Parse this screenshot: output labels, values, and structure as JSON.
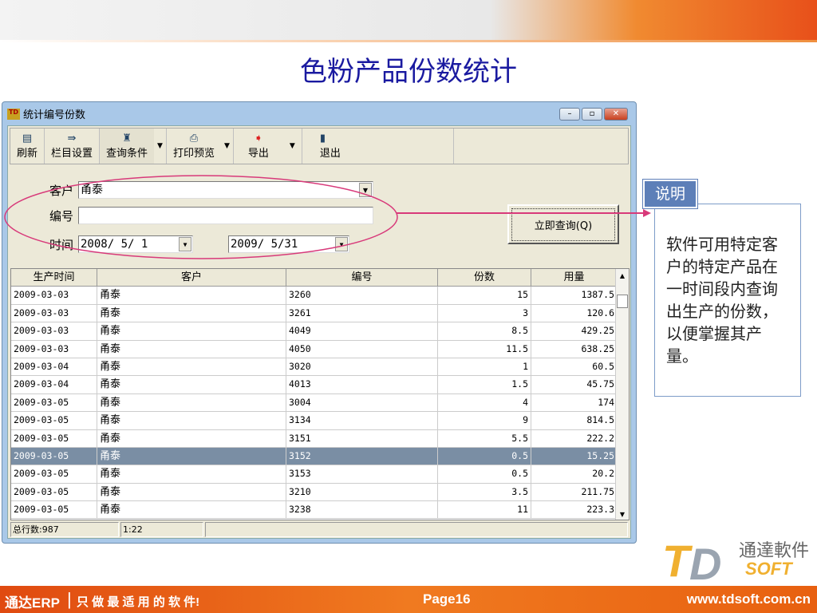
{
  "slide": {
    "title": "色粉产品份数统计",
    "page": "Page16",
    "url": "www.tdsoft.com.cn",
    "footer_brand": "通达ERP",
    "footer_slogan": "只 做 最 适 用 的 软 件!",
    "logo_text": "通達軟件",
    "logo_sub": "SOFT",
    "logo_mark": "TD"
  },
  "window": {
    "title": "统计编号份数",
    "min": "–",
    "max": "▫",
    "close": "✕"
  },
  "toolbar": [
    {
      "label": "刷新",
      "icon": "▤"
    },
    {
      "label": "栏目设置",
      "icon": "⇛"
    },
    {
      "label": "查询条件",
      "icon": "♜"
    },
    {
      "label": "打印预览",
      "icon": "⎙"
    },
    {
      "label": "导出",
      "icon": "➧"
    },
    {
      "label": "退出",
      "icon": "▮"
    }
  ],
  "form": {
    "customer_label": "客户",
    "customer_value": "甬泰",
    "code_label": "编号",
    "code_value": "",
    "time_label": "时间",
    "date_from": "2008/ 5/ 1",
    "date_to": "2009/ 5/31",
    "query_button": "立即查询(Q)"
  },
  "grid": {
    "columns": [
      "生产时间",
      "客户",
      "编号",
      "份数",
      "用量"
    ],
    "rows": [
      [
        "2009-03-03",
        "甬泰",
        "3260",
        "15",
        "1387.5"
      ],
      [
        "2009-03-03",
        "甬泰",
        "3261",
        "3",
        "120.6"
      ],
      [
        "2009-03-03",
        "甬泰",
        "4049",
        "8.5",
        "429.25"
      ],
      [
        "2009-03-03",
        "甬泰",
        "4050",
        "11.5",
        "638.25"
      ],
      [
        "2009-03-04",
        "甬泰",
        "3020",
        "1",
        "60.5"
      ],
      [
        "2009-03-04",
        "甬泰",
        "4013",
        "1.5",
        "45.75"
      ],
      [
        "2009-03-05",
        "甬泰",
        "3004",
        "4",
        "174"
      ],
      [
        "2009-03-05",
        "甬泰",
        "3134",
        "9",
        "814.5"
      ],
      [
        "2009-03-05",
        "甬泰",
        "3151",
        "5.5",
        "222.2"
      ],
      [
        "2009-03-05",
        "甬泰",
        "3152",
        "0.5",
        "15.25"
      ],
      [
        "2009-03-05",
        "甬泰",
        "3153",
        "0.5",
        "20.2"
      ],
      [
        "2009-03-05",
        "甬泰",
        "3210",
        "3.5",
        "211.75"
      ],
      [
        "2009-03-05",
        "甬泰",
        "3238",
        "11",
        "223.3"
      ]
    ],
    "selected_row": 9
  },
  "status": {
    "total": "总行数:987",
    "position": "1:22"
  },
  "note": {
    "tab": "说明",
    "text": "软件可用特定客户的特定产品在一时间段内查询出生产的份数，以便掌握其产量。"
  }
}
